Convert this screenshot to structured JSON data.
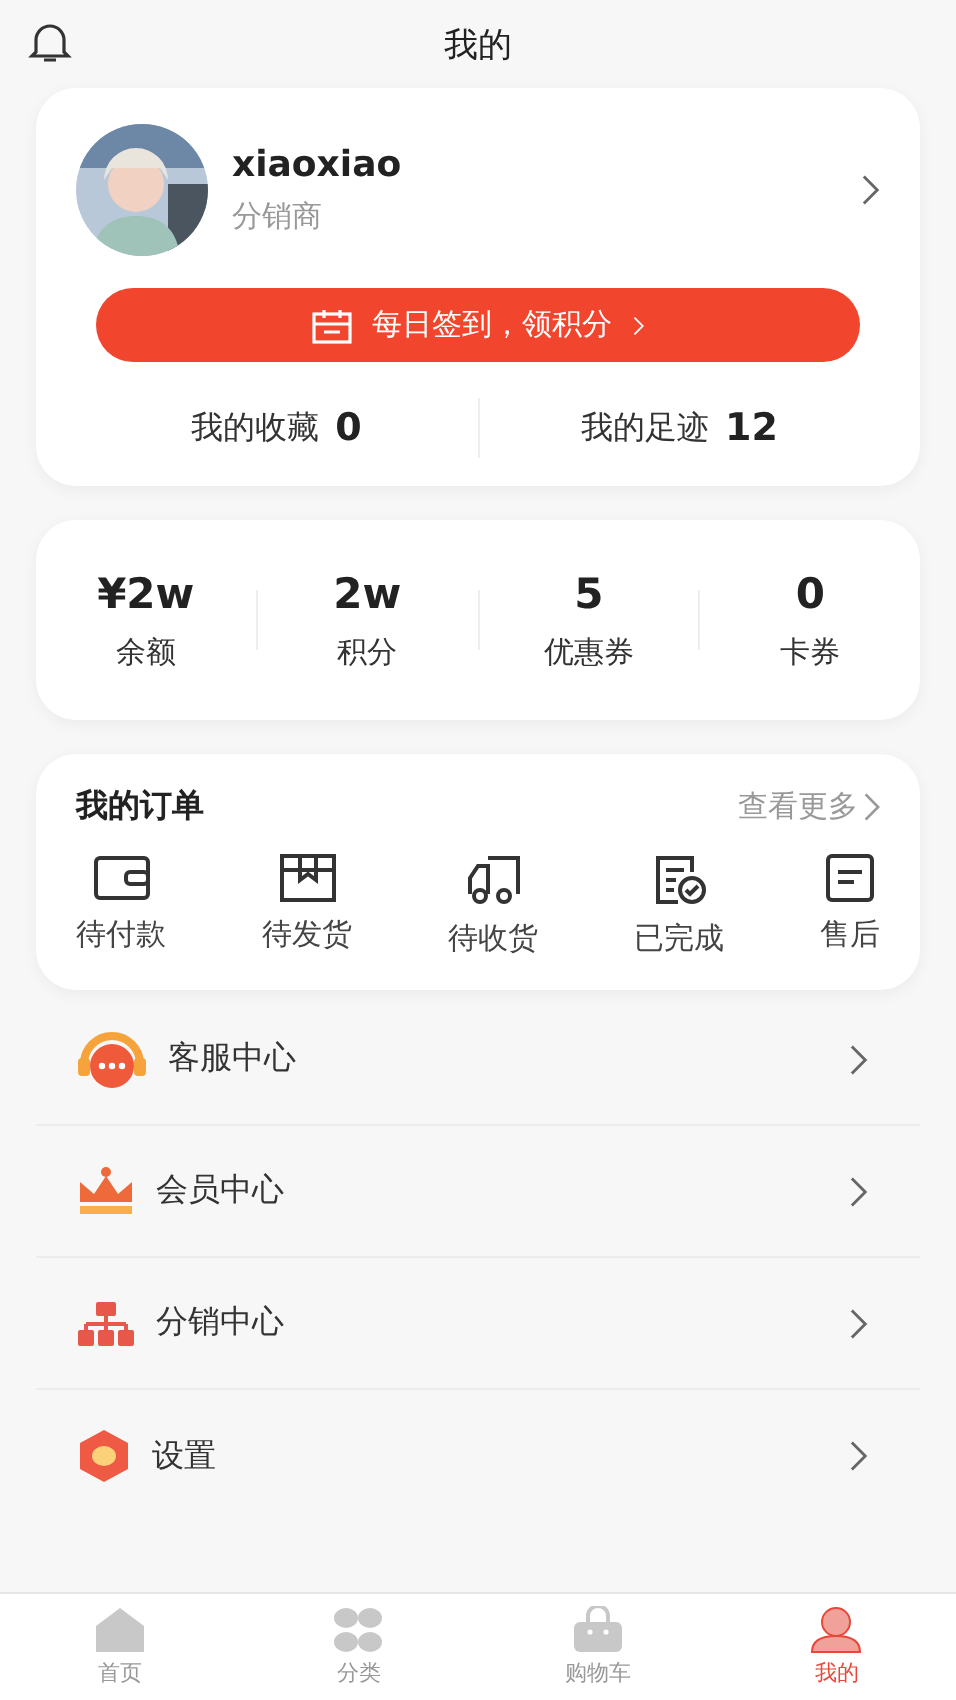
{
  "header": {
    "title": "我的"
  },
  "profile": {
    "name": "xiaoxiao",
    "role": "分销商",
    "sign_in": "每日签到，领积分",
    "stats": [
      {
        "label": "我的收藏",
        "value": "0"
      },
      {
        "label": "我的足迹",
        "value": "12"
      }
    ]
  },
  "wallet": [
    {
      "value": "¥2w",
      "label": "余额"
    },
    {
      "value": "2w",
      "label": "积分"
    },
    {
      "value": "5",
      "label": "优惠券"
    },
    {
      "value": "0",
      "label": "卡券"
    }
  ],
  "orders": {
    "title": "我的订单",
    "more": "查看更多",
    "items": [
      {
        "kind": "wallet",
        "label": "待付款"
      },
      {
        "kind": "box",
        "label": "待发货"
      },
      {
        "kind": "truck",
        "label": "待收货"
      },
      {
        "kind": "done",
        "label": "已完成"
      },
      {
        "kind": "aftersale",
        "label": "售后"
      }
    ]
  },
  "menu": [
    {
      "kind": "service",
      "label": "客服中心"
    },
    {
      "kind": "member",
      "label": "会员中心"
    },
    {
      "kind": "distribution",
      "label": "分销中心"
    },
    {
      "kind": "settings",
      "label": "设置"
    }
  ],
  "tab_bar": [
    {
      "kind": "home",
      "label": "首页",
      "selected": false
    },
    {
      "kind": "category",
      "label": "分类",
      "selected": false
    },
    {
      "kind": "cart",
      "label": "购物车",
      "selected": false
    },
    {
      "kind": "me",
      "label": "我的",
      "selected": true
    }
  ]
}
